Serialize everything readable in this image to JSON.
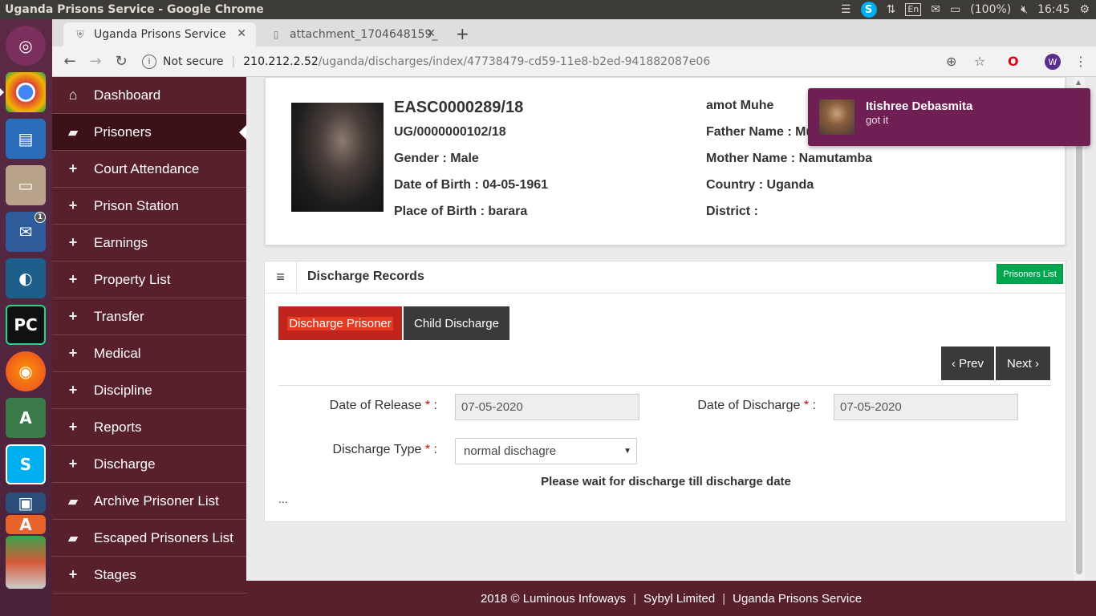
{
  "os": {
    "window_title": "Uganda Prisons Service - Google Chrome",
    "keyboard_layout": "En",
    "battery": "(100%)",
    "time": "16:45"
  },
  "launcher": {
    "apps": [
      "ubuntu-dash",
      "chrome",
      "libreoffice-writer",
      "files",
      "thunderbird",
      "mysql-workbench",
      "pycharm",
      "firefox",
      "android-studio",
      "skype",
      "virtualbox",
      "software-center",
      "trash"
    ],
    "thunderbird_badge": "1"
  },
  "browser": {
    "tabs": [
      {
        "title": "Uganda Prisons Service"
      },
      {
        "title": "attachment_1704648159_"
      }
    ],
    "security_label": "Not secure",
    "url_host": "210.212.2.52",
    "url_path": "/uganda/discharges/index/47738479-cd59-11e8-b2ed-941882087e06",
    "profile_initial": "W"
  },
  "sidebar": {
    "items": [
      {
        "label": "Dashboard",
        "icon": "home-icon"
      },
      {
        "label": "Prisoners",
        "icon": "folder-open-icon",
        "active": true
      },
      {
        "label": "Court Attendance",
        "icon": "plus-icon"
      },
      {
        "label": "Prison Station",
        "icon": "plus-icon"
      },
      {
        "label": "Earnings",
        "icon": "plus-icon"
      },
      {
        "label": "Property List",
        "icon": "plus-icon"
      },
      {
        "label": "Transfer",
        "icon": "plus-icon"
      },
      {
        "label": "Medical",
        "icon": "plus-icon"
      },
      {
        "label": "Discipline",
        "icon": "plus-icon"
      },
      {
        "label": "Reports",
        "icon": "plus-icon"
      },
      {
        "label": "Discharge",
        "icon": "plus-icon"
      },
      {
        "label": "Archive Prisoner List",
        "icon": "folder-open-icon"
      },
      {
        "label": "Escaped Prisoners List",
        "icon": "folder-open-icon"
      },
      {
        "label": "Stages",
        "icon": "plus-icon"
      }
    ]
  },
  "profile": {
    "prisoner_no": "EASC0000289/18",
    "ug_no": "UG/0000000102/18",
    "gender": "Gender : Male",
    "dob": "Date of Birth : 04-05-1961",
    "place_of_birth": "Place of Birth : barara",
    "name": "amot Muhe",
    "father": "Father Name : Mugaya",
    "mother": "Mother Name : Namutamba",
    "country": "Country : Uganda",
    "district": "District :"
  },
  "records": {
    "title": "Discharge Records",
    "prisoners_list_btn": "Prisoners List",
    "tab_discharge": "Discharge Prisoner",
    "tab_child": "Child Discharge",
    "prev": "‹ Prev",
    "next": "Next ›",
    "release_label": "Date of Release",
    "release_value": "07-05-2020",
    "discharge_label": "Date of Discharge",
    "discharge_value": "07-05-2020",
    "type_label": "Discharge Type",
    "type_value": "normal dischagre",
    "required_mark": "*",
    "colon": ":",
    "wait_message": "Please wait for discharge till discharge date",
    "ellipsis": "..."
  },
  "footer": {
    "copyright": "2018 © Luminous Infoways",
    "company": "Sybyl Limited",
    "org": "Uganda Prisons Service"
  },
  "notification": {
    "sender": "Itishree Debasmita",
    "message": "got it"
  },
  "colors": {
    "sidebar": "#58202a",
    "sidebar_active": "#3d1118",
    "discharge_tab": "#c0241d",
    "dark_button": "#3a3a3a",
    "green_button": "#00a650",
    "toast": "#701f55"
  }
}
